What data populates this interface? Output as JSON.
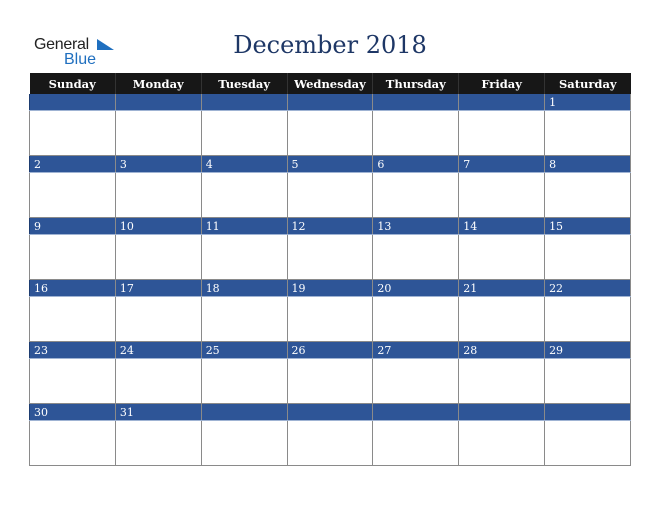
{
  "logo": {
    "word1": "General",
    "word2": "Blue",
    "icon": "triangle-flag-icon"
  },
  "title": "December 2018",
  "weekdays": [
    "Sunday",
    "Monday",
    "Tuesday",
    "Wednesday",
    "Thursday",
    "Friday",
    "Saturday"
  ],
  "weeks": [
    [
      "",
      "",
      "",
      "",
      "",
      "",
      "1"
    ],
    [
      "2",
      "3",
      "4",
      "5",
      "6",
      "7",
      "8"
    ],
    [
      "9",
      "10",
      "11",
      "12",
      "13",
      "14",
      "15"
    ],
    [
      "16",
      "17",
      "18",
      "19",
      "20",
      "21",
      "22"
    ],
    [
      "23",
      "24",
      "25",
      "26",
      "27",
      "28",
      "29"
    ],
    [
      "30",
      "31",
      "",
      "",
      "",
      "",
      ""
    ]
  ],
  "colors": {
    "header_bg": "#171717",
    "date_bar": "#2e5597",
    "title": "#1e3766",
    "logo_blue": "#1f6fbf"
  }
}
